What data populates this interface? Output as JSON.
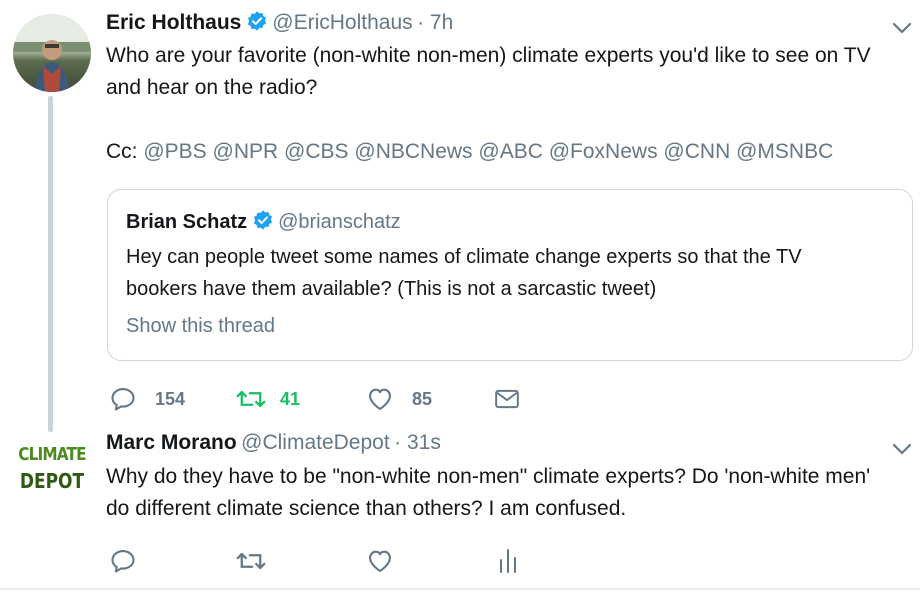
{
  "tweet1": {
    "name": "Eric Holthaus",
    "handle": "@EricHolthaus",
    "time": "· 7h",
    "text_line1": "Who are your favorite (non-white non-men) climate experts you'd like to see on TV",
    "text_line2": "and hear on the radio?",
    "cc_label": "Cc:",
    "mentions": [
      "@PBS",
      "@NPR",
      "@CBS",
      "@NBCNews",
      "@ABC",
      "@FoxNews",
      "@CNN",
      "@MSNBC"
    ],
    "quote": {
      "name": "Brian Schatz",
      "handle": "@brianschatz",
      "text_line1": "Hey can people tweet some names of climate change experts so that the TV",
      "text_line2": "bookers have them available? (This is not a sarcastic tweet)",
      "show_thread": "Show this thread"
    },
    "actions": {
      "replies": "154",
      "retweets": "41",
      "likes": "85"
    }
  },
  "tweet2": {
    "name": "Marc Morano",
    "handle": "@ClimateDepot",
    "time": "· 31s",
    "avatar_text_line1": "CLIMATE",
    "avatar_text_line2": "DEPOT",
    "text_line1": "Why do they have to be \"non-white non-men\" climate experts? Do 'non-white men'",
    "text_line2": "do different climate science than others?  I am confused."
  },
  "colors": {
    "verified": "#1da1f2",
    "retweet_active": "#17bf63",
    "muted": "#657786",
    "thread_line": "#c8d3dc"
  },
  "icons": [
    "verified-badge-icon",
    "chevron-down-icon",
    "reply-icon",
    "retweet-icon",
    "like-icon",
    "direct-message-icon",
    "analytics-icon"
  ]
}
